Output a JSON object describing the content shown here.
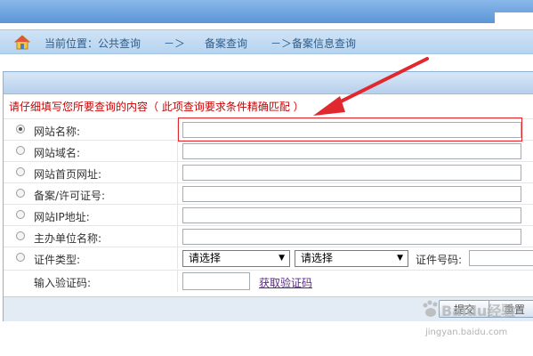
{
  "breadcrumb": {
    "location_label": "当前位置：公共查询",
    "separator1": "－＞",
    "item2": "备案查询",
    "separator2_item3": "－＞备案信息查询"
  },
  "form": {
    "instruction": "请仔细填写您所要查询的内容（ 此项查询要求条件精确匹配 ）",
    "rows": [
      {
        "label": "网站名称:",
        "checked": true
      },
      {
        "label": "网站域名:",
        "checked": false
      },
      {
        "label": "网站首页网址:",
        "checked": false
      },
      {
        "label": "备案/许可证号:",
        "checked": false
      },
      {
        "label": "网站IP地址:",
        "checked": false
      },
      {
        "label": "主办单位名称:",
        "checked": false
      },
      {
        "label": "证件类型:",
        "checked": false
      }
    ],
    "cert_type_select1": "请选择",
    "cert_type_select2": "请选择",
    "cert_number_label": "证件号码:",
    "captcha_label": "输入验证码:",
    "captcha_link": "获取验证码"
  },
  "buttons": {
    "submit": "提交",
    "reset": "重置"
  },
  "watermark": {
    "text": "Baidu经验",
    "url": "jingyan.baidu.com"
  },
  "colors": {
    "instruction": "#cc0000",
    "highlight": "#e0282e",
    "arrow": "#e0282e"
  },
  "icons": {
    "home": "home-icon",
    "arrow": "annotation-arrow"
  }
}
